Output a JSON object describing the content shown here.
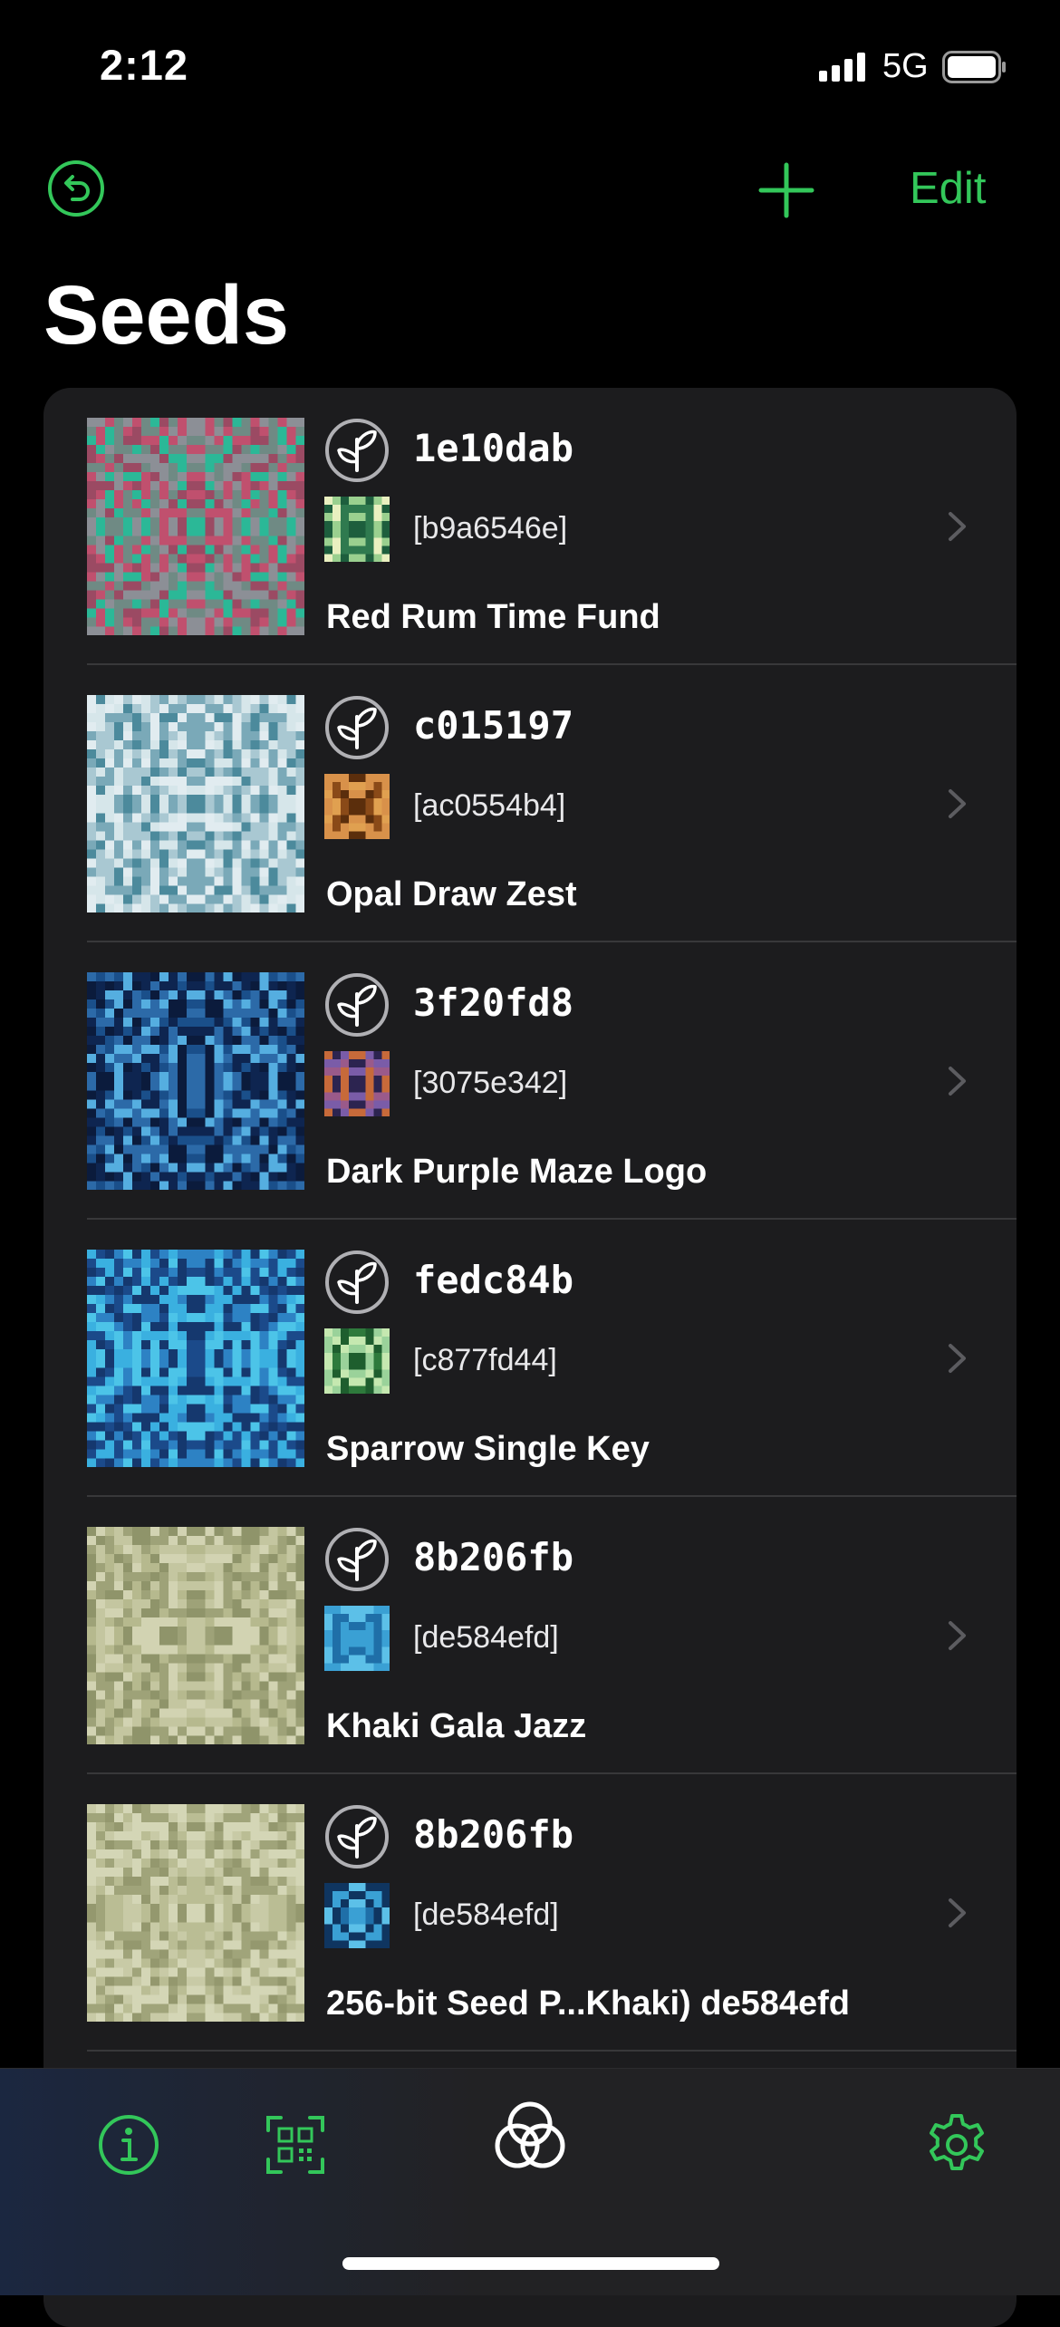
{
  "status_bar": {
    "time": "2:12",
    "network": "5G"
  },
  "nav": {
    "edit_label": "Edit"
  },
  "page_title": "Seeds",
  "colors": {
    "accent": "#33c75a",
    "background": "#000000",
    "card": "#1c1c1e"
  },
  "seeds": [
    {
      "id": "1e10dab",
      "fingerprint": "[b9a6546e]",
      "name": "Red Rum Time Fund",
      "lifehash": {
        "bg": "#b0536a",
        "cells": [
          "#c0506e",
          "#6f8a84",
          "#2bb897",
          "#9b4a63",
          "#8c8f96"
        ]
      },
      "mini": {
        "bg": "#c5e2a5",
        "cells": [
          "#2f7a4f",
          "#e9f0c0",
          "#1d5e3d",
          "#9ad08f"
        ]
      }
    },
    {
      "id": "c015197",
      "fingerprint": "[ac0554b4]",
      "name": "Opal Draw Zest",
      "lifehash": {
        "bg": "#c8dde4",
        "cells": [
          "#e1ecf0",
          "#a9c8d2",
          "#7aa9b8",
          "#d6e6ea",
          "#4c8a9c"
        ]
      },
      "mini": {
        "bg": "#c27b2d",
        "cells": [
          "#8a4a18",
          "#e0a050",
          "#5b2e0c",
          "#d8914a"
        ]
      }
    },
    {
      "id": "3f20fd8",
      "fingerprint": "[3075e342]",
      "name": "Dark Purple Maze Logo",
      "lifehash": {
        "bg": "#163a6a",
        "cells": [
          "#0e2550",
          "#2c6aa8",
          "#55aee0",
          "#1a4f8a",
          "#0b1b3c"
        ]
      },
      "mini": {
        "bg": "#4b3a6e",
        "cells": [
          "#7a5ca8",
          "#c76a3a",
          "#2c2450",
          "#9a5a8a"
        ]
      }
    },
    {
      "id": "fedc84b",
      "fingerprint": "[c877fd44]",
      "name": "Sparrow Single Key",
      "lifehash": {
        "bg": "#1f5a9a",
        "cells": [
          "#15386e",
          "#2d82c4",
          "#3ab0e0",
          "#1b4a8a",
          "#4cc4e8"
        ]
      },
      "mini": {
        "bg": "#5aa860",
        "cells": [
          "#2e7a3c",
          "#9ad29a",
          "#1e5e2e",
          "#c5e8b0"
        ]
      }
    },
    {
      "id": "8b206fb",
      "fingerprint": "[de584efd]",
      "name": "Khaki Gala Jazz",
      "lifehash": {
        "bg": "#aeb28a",
        "cells": [
          "#c4c6a0",
          "#9ea278",
          "#d2d3b2",
          "#b6b98e",
          "#8f946a"
        ]
      },
      "mini": {
        "bg": "#1c5a8e",
        "cells": [
          "#0f3560",
          "#3aa0d4",
          "#1f6fa8",
          "#5cc0e8"
        ]
      }
    },
    {
      "id": "8b206fb",
      "fingerprint": "[de584efd]",
      "name": "256-bit Seed P...Khaki) de584efd",
      "lifehash": {
        "bg": "#b2b690",
        "cells": [
          "#c8caa6",
          "#a0a47a",
          "#d4d6b6",
          "#babd94",
          "#94986e"
        ]
      },
      "mini": {
        "bg": "#1c5a8e",
        "cells": [
          "#0f3560",
          "#3aa0d4",
          "#1f6fa8",
          "#5cc0e8"
        ]
      }
    }
  ],
  "tabbar": {
    "items": [
      "info-icon",
      "qr-scan-icon",
      "blockchain-commons-logo-icon",
      "settings-gear-icon"
    ]
  }
}
